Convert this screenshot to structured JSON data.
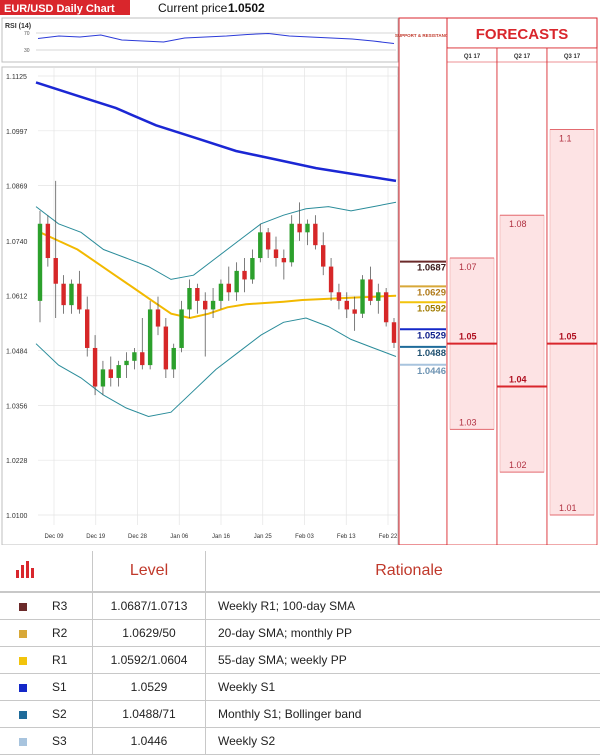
{
  "header": {
    "badge": "EUR/USD Daily Chart",
    "price_label": "Current price",
    "price_value": "1.0502"
  },
  "chart_data": {
    "type": "candlestick",
    "title": "EUR/USD Daily Chart",
    "rsi_label": "RSI (14)",
    "rsi_ticks": [
      "70",
      "30"
    ],
    "y_ticks": [
      "1.1125",
      "1.0997",
      "1.0869",
      "1.0740",
      "1.0612",
      "1.0484",
      "1.0356",
      "1.0228",
      "1.0100"
    ],
    "ylim": [
      1.01,
      1.1125
    ],
    "x_ticks": [
      "Dec 09",
      "Dec 19",
      "Dec 28",
      "Jan 06",
      "Jan 16",
      "Jan 25",
      "Feb 03",
      "Feb 13",
      "Feb 22"
    ],
    "candles": [
      [
        1.06,
        1.081,
        1.055,
        1.078
      ],
      [
        1.078,
        1.08,
        1.068,
        1.07
      ],
      [
        1.07,
        1.088,
        1.056,
        1.064
      ],
      [
        1.064,
        1.066,
        1.057,
        1.059
      ],
      [
        1.059,
        1.065,
        1.057,
        1.064
      ],
      [
        1.064,
        1.067,
        1.057,
        1.058
      ],
      [
        1.058,
        1.061,
        1.047,
        1.049
      ],
      [
        1.049,
        1.052,
        1.038,
        1.04
      ],
      [
        1.04,
        1.046,
        1.038,
        1.044
      ],
      [
        1.044,
        1.047,
        1.04,
        1.042
      ],
      [
        1.042,
        1.046,
        1.04,
        1.045
      ],
      [
        1.045,
        1.048,
        1.042,
        1.046
      ],
      [
        1.046,
        1.049,
        1.044,
        1.048
      ],
      [
        1.048,
        1.056,
        1.044,
        1.045
      ],
      [
        1.045,
        1.06,
        1.044,
        1.058
      ],
      [
        1.058,
        1.061,
        1.052,
        1.054
      ],
      [
        1.054,
        1.056,
        1.042,
        1.044
      ],
      [
        1.044,
        1.05,
        1.042,
        1.049
      ],
      [
        1.049,
        1.06,
        1.048,
        1.058
      ],
      [
        1.058,
        1.065,
        1.056,
        1.063
      ],
      [
        1.063,
        1.064,
        1.057,
        1.06
      ],
      [
        1.06,
        1.062,
        1.047,
        1.058
      ],
      [
        1.058,
        1.063,
        1.056,
        1.06
      ],
      [
        1.06,
        1.065,
        1.058,
        1.064
      ],
      [
        1.064,
        1.068,
        1.06,
        1.062
      ],
      [
        1.062,
        1.069,
        1.06,
        1.067
      ],
      [
        1.067,
        1.07,
        1.062,
        1.065
      ],
      [
        1.065,
        1.072,
        1.064,
        1.07
      ],
      [
        1.07,
        1.078,
        1.069,
        1.076
      ],
      [
        1.076,
        1.077,
        1.07,
        1.072
      ],
      [
        1.072,
        1.075,
        1.068,
        1.07
      ],
      [
        1.07,
        1.072,
        1.065,
        1.069
      ],
      [
        1.069,
        1.08,
        1.068,
        1.078
      ],
      [
        1.078,
        1.083,
        1.074,
        1.076
      ],
      [
        1.076,
        1.079,
        1.073,
        1.078
      ],
      [
        1.078,
        1.08,
        1.072,
        1.073
      ],
      [
        1.073,
        1.076,
        1.066,
        1.068
      ],
      [
        1.068,
        1.07,
        1.06,
        1.062
      ],
      [
        1.062,
        1.064,
        1.058,
        1.06
      ],
      [
        1.06,
        1.062,
        1.056,
        1.058
      ],
      [
        1.058,
        1.061,
        1.053,
        1.057
      ],
      [
        1.057,
        1.066,
        1.056,
        1.065
      ],
      [
        1.065,
        1.068,
        1.059,
        1.06
      ],
      [
        1.06,
        1.064,
        1.057,
        1.062
      ],
      [
        1.062,
        1.063,
        1.054,
        1.055
      ],
      [
        1.055,
        1.056,
        1.049,
        1.0502
      ]
    ],
    "sma55": [
      1.076,
      1.074,
      1.072,
      1.069,
      1.066,
      1.063,
      1.06,
      1.057,
      1.056,
      1.057,
      1.0585,
      1.0592,
      1.0595,
      1.0598,
      1.0602,
      1.0604,
      1.0606,
      1.0608,
      1.061,
      1.0612
    ],
    "sma100": [
      1.111,
      1.108,
      1.105,
      1.101,
      1.098,
      1.095,
      1.093,
      1.091,
      1.0895,
      1.088
    ],
    "bb_upper": [
      1.082,
      1.078,
      1.076,
      1.072,
      1.07,
      1.068,
      1.065,
      1.066,
      1.07,
      1.074,
      1.078,
      1.08,
      1.0815,
      1.082,
      1.081,
      1.082,
      1.083
    ],
    "bb_lower": [
      1.05,
      1.045,
      1.042,
      1.038,
      1.035,
      1.033,
      1.034,
      1.039,
      1.044,
      1.048,
      1.052,
      1.055,
      1.056,
      1.054,
      1.051,
      1.049,
      1.047
    ],
    "rsi": [
      55,
      60,
      58,
      62,
      52,
      50,
      48,
      56,
      58,
      60,
      63,
      65,
      60,
      58,
      56,
      54,
      50,
      45
    ]
  },
  "levels_panel": {
    "header": "SUPPORT & RESISTANCE",
    "labels": [
      {
        "text": "1.0687",
        "value": 1.0687,
        "color": "#6b2a2a",
        "text_color": "#3a1a1a"
      },
      {
        "text": "1.0629",
        "value": 1.0629,
        "color": "#d8a838",
        "text_color": "#b07a1a"
      },
      {
        "text": "1.0592",
        "value": 1.0592,
        "color": "#f2c40c",
        "text_color": "#a07b00"
      },
      {
        "text": "1.0529",
        "value": 1.0529,
        "color": "#1428c8",
        "text_color": "#10208c"
      },
      {
        "text": "1.0488",
        "value": 1.0488,
        "color": "#1f6b9a",
        "text_color": "#1f5070"
      },
      {
        "text": "1.0446",
        "value": 1.0446,
        "color": "#a8c4de",
        "text_color": "#6d93b2"
      }
    ]
  },
  "forecasts": {
    "title": "FORECASTS",
    "quarters": [
      {
        "label": "Q1 17",
        "high": "1.07",
        "high_val": 1.07,
        "mid": "1.05",
        "mid_val": 1.05,
        "low": "1.03",
        "low_val": 1.03
      },
      {
        "label": "Q2 17",
        "high": "1.08",
        "high_val": 1.08,
        "mid": "1.04",
        "mid_val": 1.04,
        "low": "1.02",
        "low_val": 1.02
      },
      {
        "label": "Q3 17",
        "high": "1.1",
        "high_val": 1.1,
        "mid": "1.05",
        "mid_val": 1.05,
        "low": "1.01",
        "low_val": 1.01
      }
    ]
  },
  "table": {
    "header_level": "Level",
    "header_rationale": "Rationale",
    "rows": [
      {
        "name": "R3",
        "level": "1.0687/1.0713",
        "rationale": "Weekly R1; 100-day SMA",
        "color": "#6b2a2a"
      },
      {
        "name": "R2",
        "level": "1.0629/50",
        "rationale": "20-day SMA; monthly PP",
        "color": "#d8a838"
      },
      {
        "name": "R1",
        "level": "1.0592/1.0604",
        "rationale": "55-day SMA; weekly PP",
        "color": "#f2c40c"
      },
      {
        "name": "S1",
        "level": "1.0529",
        "rationale": "Weekly S1",
        "color": "#1428c8"
      },
      {
        "name": "S2",
        "level": "1.0488/71",
        "rationale": "Monthly S1; Bollinger band",
        "color": "#1f6b9a"
      },
      {
        "name": "S3",
        "level": "1.0446",
        "rationale": "Weekly S2",
        "color": "#a8c4de"
      }
    ]
  }
}
